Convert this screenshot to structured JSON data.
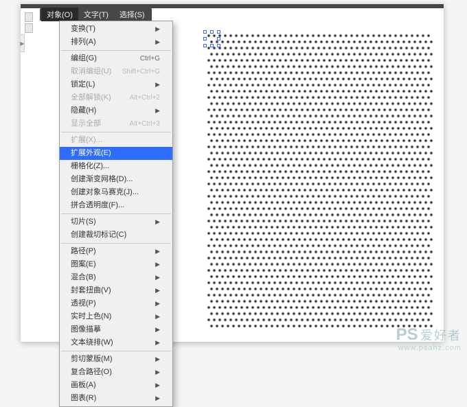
{
  "menubar": {
    "items": [
      {
        "label": "对象(O)"
      },
      {
        "label": "文字(T)"
      },
      {
        "label": "选择(S)"
      }
    ]
  },
  "menu": {
    "transform": {
      "label": "变换(T)"
    },
    "arrange": {
      "label": "排列(A)"
    },
    "group": {
      "label": "编组(G)",
      "shortcut": "Ctrl+G"
    },
    "ungroup": {
      "label": "取消编组(U)",
      "shortcut": "Shift+Ctrl+G"
    },
    "lock": {
      "label": "锁定(L)"
    },
    "unlock_all": {
      "label": "全部解锁(K)",
      "shortcut": "Alt+Ctrl+2"
    },
    "hide": {
      "label": "隐藏(H)"
    },
    "show_all": {
      "label": "显示全部",
      "shortcut": "Alt+Ctrl+3"
    },
    "expand": {
      "label": "扩展(X)..."
    },
    "expand_appearance": {
      "label": "扩展外观(E)"
    },
    "rasterize": {
      "label": "栅格化(Z)..."
    },
    "gradient_mesh": {
      "label": "创建渐变网格(D)..."
    },
    "object_mosaic": {
      "label": "创建对象马赛克(J)..."
    },
    "flatten_trans": {
      "label": "拼合透明度(F)..."
    },
    "slice": {
      "label": "切片(S)"
    },
    "crop_marks": {
      "label": "创建裁切标记(C)"
    },
    "path": {
      "label": "路径(P)"
    },
    "pattern": {
      "label": "图案(E)"
    },
    "blend": {
      "label": "混合(B)"
    },
    "envelope": {
      "label": "封套扭曲(V)"
    },
    "perspective": {
      "label": "透视(P)"
    },
    "live_paint": {
      "label": "实时上色(N)"
    },
    "image_trace": {
      "label": "图像描摹"
    },
    "text_wrap": {
      "label": "文本绕排(W)"
    },
    "clipping_mask": {
      "label": "剪切蒙版(M)"
    },
    "compound_path": {
      "label": "复合路径(O)"
    },
    "artboards": {
      "label": "画板(A)"
    },
    "graph": {
      "label": "图表(R)"
    }
  },
  "canvas_toggle": "▶",
  "watermark": {
    "ps": "PS",
    "han": "爱好者",
    "url": "www.psahz.com"
  }
}
